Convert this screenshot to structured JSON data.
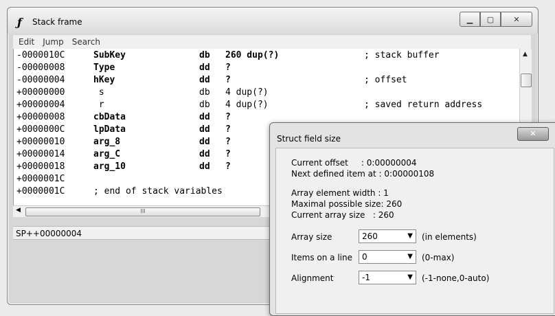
{
  "window": {
    "title": "Stack frame",
    "app_icon": "function-icon"
  },
  "menu": [
    "Edit",
    "Jump",
    "Search"
  ],
  "listing": [
    {
      "addr": "-0000010C",
      "name": "SubKey",
      "op": "db",
      "arg": "260 dup(?)",
      "cmt": "; stack buffer",
      "bold": true
    },
    {
      "addr": "-00000008",
      "name": "Type",
      "op": "dd",
      "arg": "?",
      "cmt": "",
      "bold": true
    },
    {
      "addr": "-00000004",
      "name": "hKey",
      "op": "dd",
      "arg": "?",
      "cmt": "; offset",
      "bold": true
    },
    {
      "addr": "+00000000",
      "name": " s",
      "op": "db",
      "arg": "4 dup(?)",
      "cmt": "",
      "bold": false
    },
    {
      "addr": "+00000004",
      "name": " r",
      "op": "db",
      "arg": "4 dup(?)",
      "cmt": "; saved return address",
      "bold": false
    },
    {
      "addr": "+00000008",
      "name": "cbData",
      "op": "dd",
      "arg": "?",
      "cmt": "",
      "bold": true
    },
    {
      "addr": "+0000000C",
      "name": "lpData",
      "op": "dd",
      "arg": "?",
      "cmt": "",
      "bold": true
    },
    {
      "addr": "+00000010",
      "name": "arg_8",
      "op": "dd",
      "arg": "?",
      "cmt": "",
      "bold": true
    },
    {
      "addr": "+00000014",
      "name": "arg_C",
      "op": "dd",
      "arg": "?",
      "cmt": "",
      "bold": true
    },
    {
      "addr": "+00000018",
      "name": "arg_10",
      "op": "dd",
      "arg": "?",
      "cmt": "",
      "bold": true
    },
    {
      "addr": "+0000001C",
      "name": "",
      "op": "",
      "arg": "",
      "cmt": "",
      "bold": false
    },
    {
      "addr": "+0000001C",
      "name": "; end of stack variables",
      "op": "",
      "arg": "",
      "cmt": "",
      "bold": false
    }
  ],
  "status": "SP++00000004",
  "dialog": {
    "title": "Struct field size",
    "current_offset": "Current offset     : 0:00000004",
    "next_item": "Next defined item at : 0:00000108",
    "elem_width": "Array element width : 1",
    "max_size": "Maximal possible size: 260",
    "cur_size": "Current array size   : 260",
    "array_size_label": "Array size",
    "array_size_value": "260",
    "array_size_hint": "(in elements)",
    "items_label": "Items on a line",
    "items_value": "0",
    "items_hint": "(0-max)",
    "align_label": "Alignment",
    "align_value": "-1",
    "align_hint": "(-1-none,0-auto)"
  }
}
